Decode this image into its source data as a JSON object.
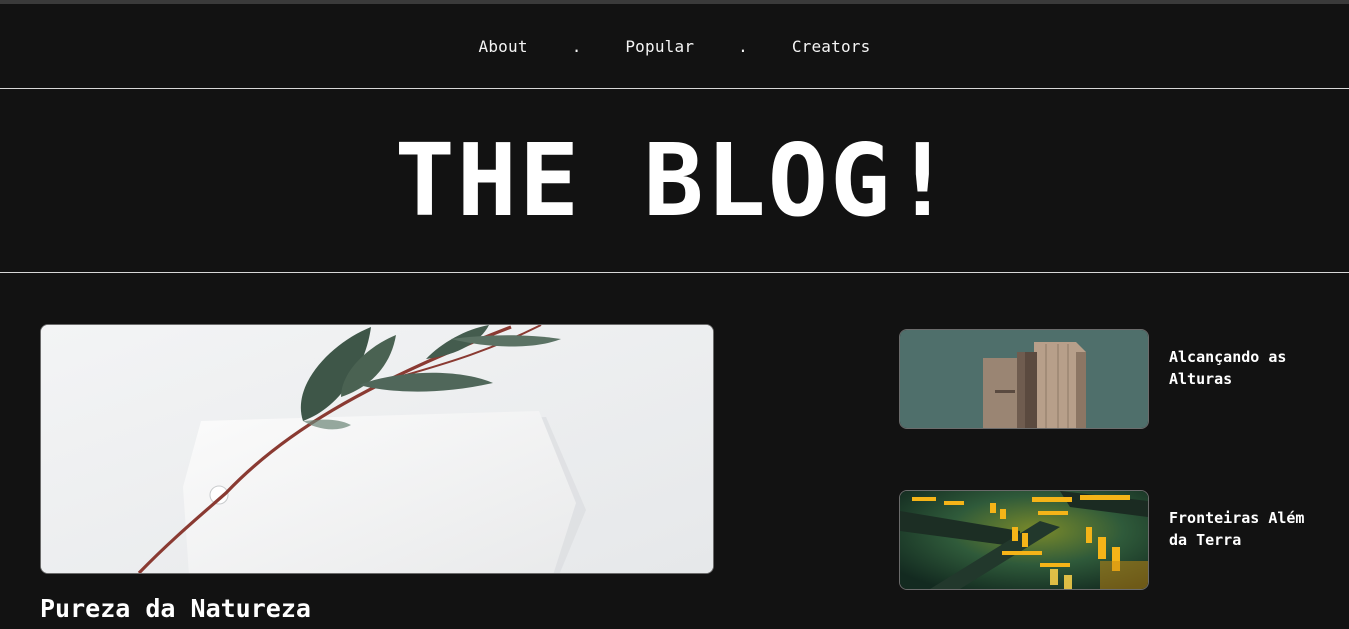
{
  "nav": {
    "links": [
      {
        "label": "About"
      },
      {
        "label": "Popular"
      },
      {
        "label": "Creators"
      }
    ],
    "separator": "."
  },
  "hero": {
    "title": "THE BLOG!"
  },
  "featured_post": {
    "title": "Pureza da Natureza",
    "image": "eucalyptus-branch-and-paper-tag"
  },
  "side_posts": [
    {
      "title": "Alcançando as Alturas",
      "image": "concrete-tower-against-teal-sky"
    },
    {
      "title": "Fronteiras Além da Terra",
      "image": "neon-futuristic-structure"
    }
  ],
  "colors": {
    "background": "#121212",
    "text": "#f4f4f4",
    "rule": "#d8d8d8"
  }
}
